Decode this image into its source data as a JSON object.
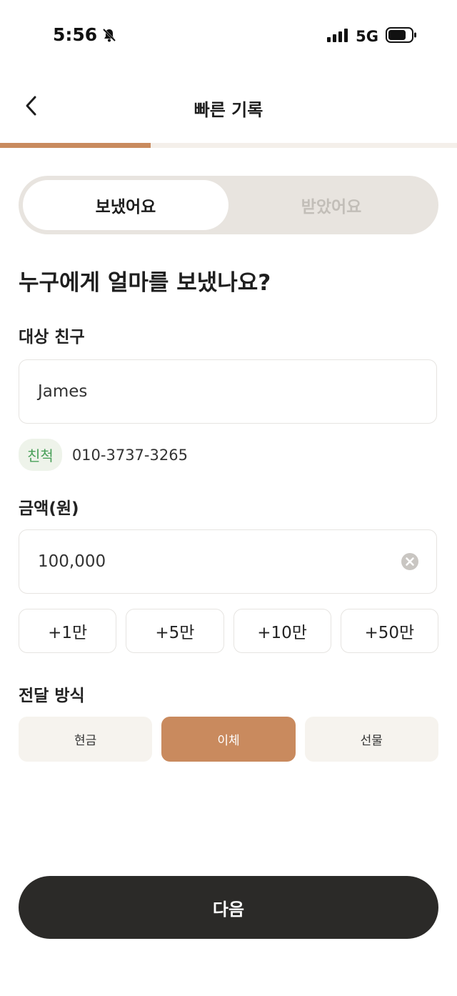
{
  "status_bar": {
    "time": "5:56",
    "network": "5G",
    "icons": [
      "bell-off-icon",
      "signal-icon",
      "battery-icon"
    ]
  },
  "header": {
    "title": "빠른 기록",
    "back_icon": "chevron-left-icon"
  },
  "progress": {
    "value": 0.33,
    "color": "#c98a5e"
  },
  "segmented": {
    "sent_label": "보냈어요",
    "received_label": "받았어요",
    "selected": "sent"
  },
  "question": "누구에게 얼마를 보냈나요?",
  "friend_section": {
    "label": "대상 친구",
    "value": "James",
    "relation": "친척",
    "phone": "010-3737-3265"
  },
  "amount_section": {
    "label": "금액(원)",
    "value": "100,000",
    "clear_icon": "clear-circle-icon",
    "quick_add": [
      "+1만",
      "+5만",
      "+10만",
      "+50만"
    ]
  },
  "method_section": {
    "label": "전달 방식",
    "options": [
      "현금",
      "이체",
      "선물"
    ],
    "selected": "이체"
  },
  "next_button": {
    "label": "다음"
  },
  "colors": {
    "accent": "#c98a5e",
    "button_dark": "#2b2a28",
    "badge_green": "#4aa05a"
  }
}
